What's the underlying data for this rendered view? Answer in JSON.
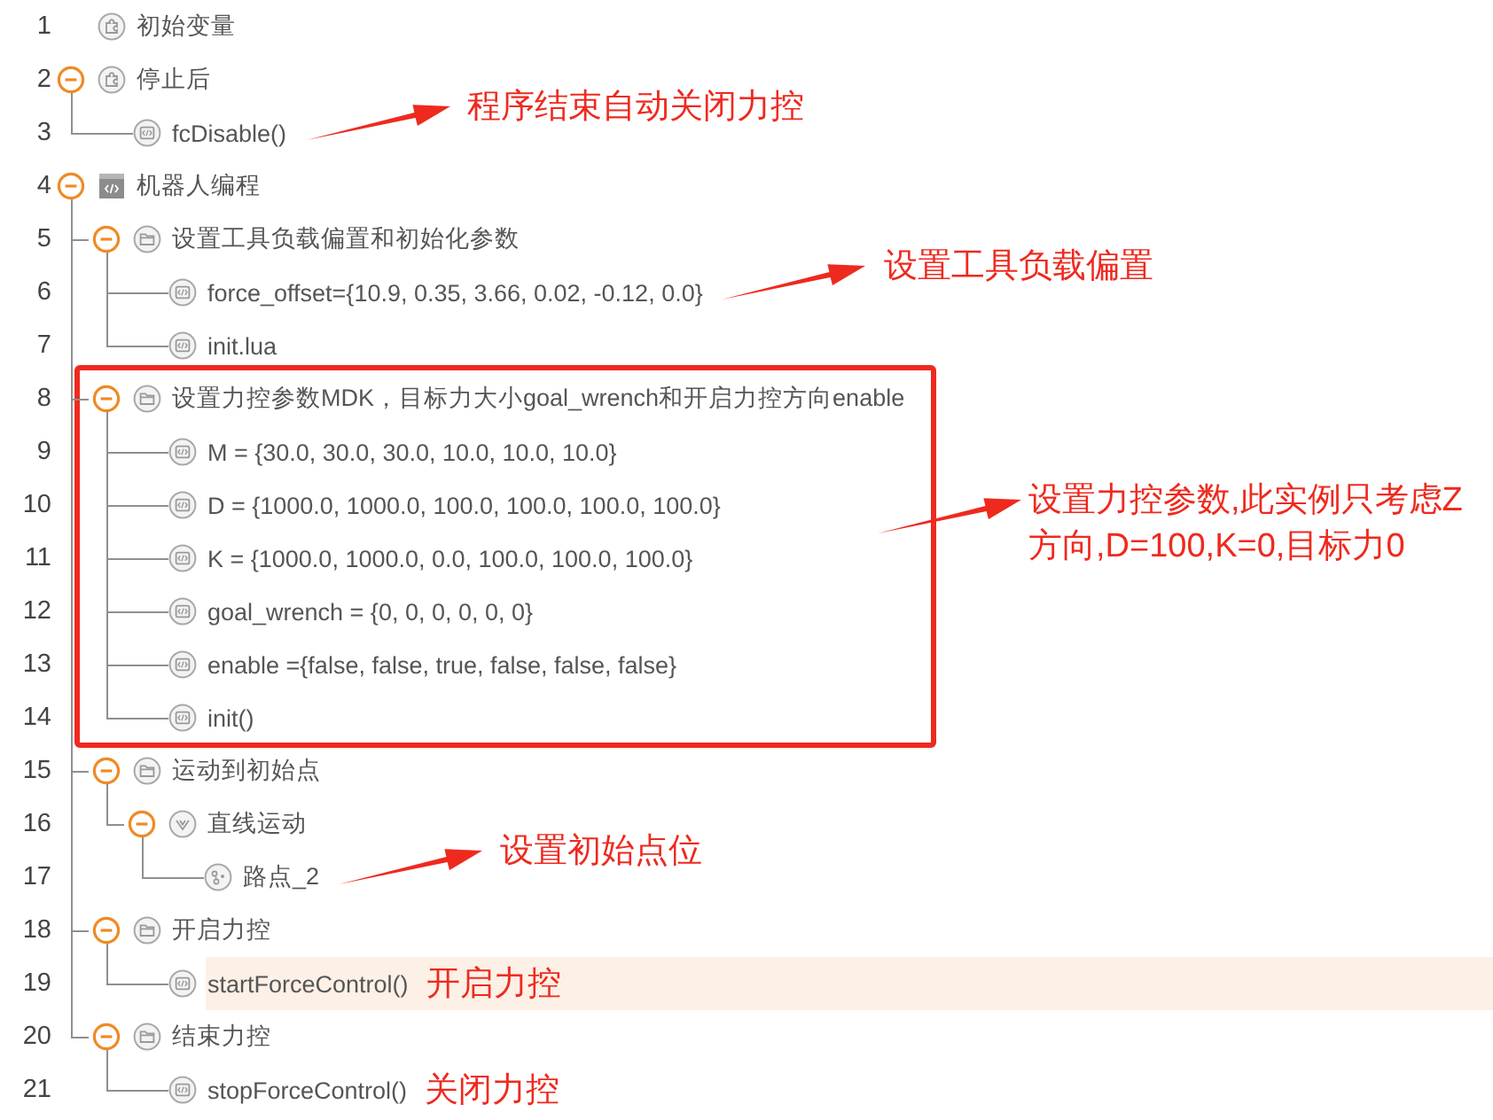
{
  "tree": [
    {
      "number": "1",
      "kind": "variable",
      "label": "初始变量"
    },
    {
      "number": "2",
      "kind": "variable",
      "label": "停止后",
      "expanded": true,
      "children": [
        {
          "number": "3",
          "kind": "code",
          "label": "fcDisable()",
          "note": {
            "text": "程序结束自动关闭力控",
            "arrow": true
          }
        }
      ]
    },
    {
      "number": "4",
      "kind": "program",
      "label": "机器人编程",
      "expanded": true,
      "children": [
        {
          "number": "5",
          "kind": "folder",
          "label": "设置工具负载偏置和初始化参数",
          "expanded": true,
          "children": [
            {
              "number": "6",
              "kind": "code",
              "label": "force_offset={10.9, 0.35, 3.66, 0.02, -0.12, 0.0}",
              "note": {
                "text": "设置工具负载偏置",
                "arrow": true
              }
            },
            {
              "number": "7",
              "kind": "code",
              "label": "init.lua"
            }
          ]
        },
        {
          "number": "8",
          "kind": "folder",
          "label": "设置力控参数MDK，目标力大小goal_wrench和开启力控方向enable",
          "expanded": true,
          "framed": true,
          "note": {
            "text": "设置力控参数,此实例只考虑Z方向,D=100,K=0,目标力0",
            "arrow": true
          },
          "children": [
            {
              "number": "9",
              "kind": "code",
              "label": "M = {30.0, 30.0, 30.0, 10.0, 10.0, 10.0}"
            },
            {
              "number": "10",
              "kind": "code",
              "label": "D = {1000.0, 1000.0, 100.0, 100.0, 100.0, 100.0}"
            },
            {
              "number": "11",
              "kind": "code",
              "label": "K = {1000.0, 1000.0, 0.0, 100.0, 100.0, 100.0}"
            },
            {
              "number": "12",
              "kind": "code",
              "label": "goal_wrench = {0, 0, 0, 0, 0, 0}"
            },
            {
              "number": "13",
              "kind": "code",
              "label": "enable ={false, false, true, false, false, false}"
            },
            {
              "number": "14",
              "kind": "code",
              "label": "init()"
            }
          ]
        },
        {
          "number": "15",
          "kind": "folder",
          "label": "运动到初始点",
          "expanded": true,
          "children": [
            {
              "number": "16",
              "kind": "move",
              "label": "直线运动",
              "expanded": true,
              "children": [
                {
                  "number": "17",
                  "kind": "waypoint",
                  "label": "路点_2",
                  "note": {
                    "text": "设置初始点位",
                    "arrow": true
                  }
                }
              ]
            }
          ]
        },
        {
          "number": "18",
          "kind": "folder",
          "label": "开启力控",
          "expanded": true,
          "children": [
            {
              "number": "19",
              "kind": "code",
              "label": "startForceControl()",
              "highlighted": true,
              "note": {
                "text": "开启力控",
                "arrow": false
              }
            }
          ]
        },
        {
          "number": "20",
          "kind": "folder",
          "label": "结束力控",
          "expanded": true,
          "children": [
            {
              "number": "21",
              "kind": "code",
              "label": "stopForceControl()",
              "note": {
                "text": "关闭力控",
                "arrow": false
              }
            }
          ]
        }
      ]
    }
  ]
}
